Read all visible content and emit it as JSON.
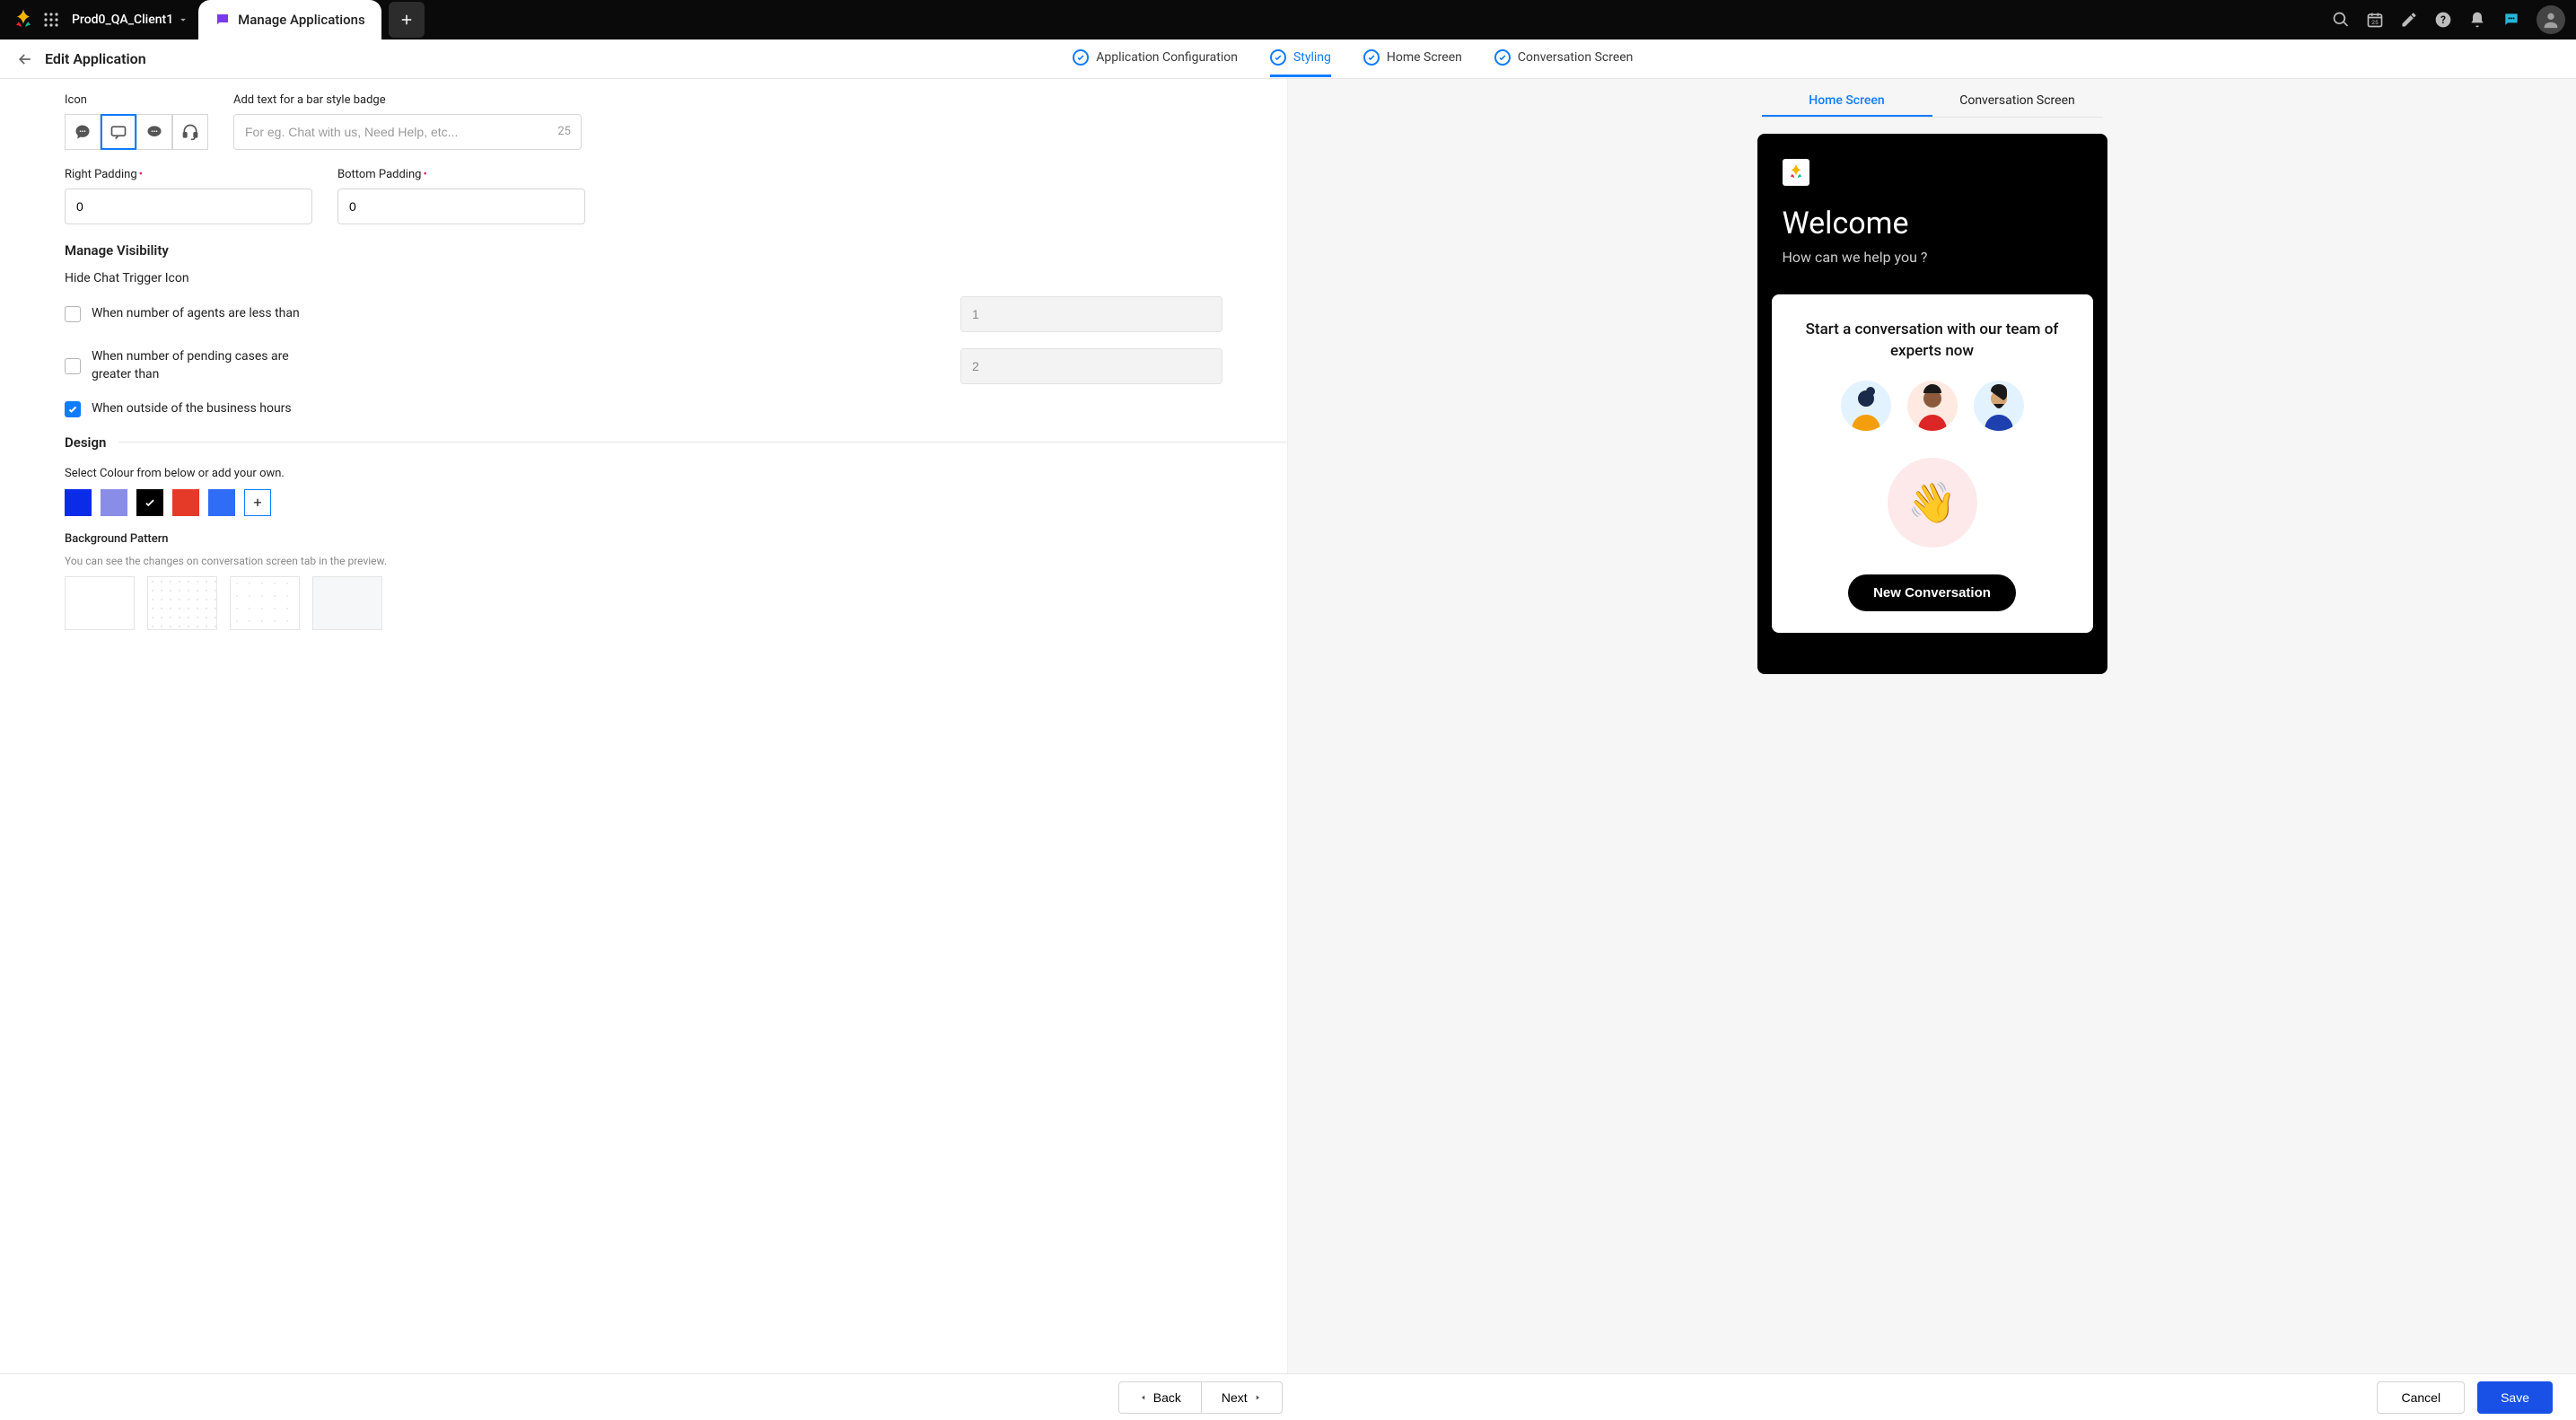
{
  "topbar": {
    "workspace": "Prod0_QA_Client1",
    "active_tab": "Manage Applications"
  },
  "subheader": {
    "title": "Edit Application",
    "steps": [
      {
        "label": "Application Configuration",
        "active": false
      },
      {
        "label": "Styling",
        "active": true
      },
      {
        "label": "Home Screen",
        "active": false
      },
      {
        "label": "Conversation Screen",
        "active": false
      }
    ]
  },
  "form": {
    "icon_label": "Icon",
    "badge_label": "Add text for a bar style badge",
    "badge_placeholder": "For eg. Chat with us, Need Help, etc...",
    "badge_char_count": "25",
    "right_padding_label": "Right Padding",
    "right_padding_value": "0",
    "bottom_padding_label": "Bottom Padding",
    "bottom_padding_value": "0",
    "visibility_title": "Manage Visibility",
    "hide_trigger_label": "Hide Chat Trigger Icon",
    "chk_agents_label": "When number of agents are less than",
    "chk_agents_value": "1",
    "chk_pending_label": "When number of pending cases are greater than",
    "chk_pending_value": "2",
    "chk_hours_label": "When outside of the business hours",
    "design_title": "Design",
    "color_instruction": "Select Colour from below or add your own.",
    "colors": [
      "#0a2be8",
      "#8a8de8",
      "#000000",
      "#e53a28",
      "#2f6df6"
    ],
    "color_selected_index": 2,
    "add_color_label": "+",
    "pattern_title": "Background Pattern",
    "pattern_sub": "You can see the changes on conversation screen tab in the preview."
  },
  "preview": {
    "tabs": [
      "Home Screen",
      "Conversation Screen"
    ],
    "active_tab": 0,
    "welcome": "Welcome",
    "subtext": "How can we help you ?",
    "card_title": "Start a conversation with our team of experts now",
    "wave_emoji": "👋",
    "new_conv_label": "New Conversation"
  },
  "footer": {
    "back": "Back",
    "next": "Next",
    "cancel": "Cancel",
    "save": "Save"
  }
}
